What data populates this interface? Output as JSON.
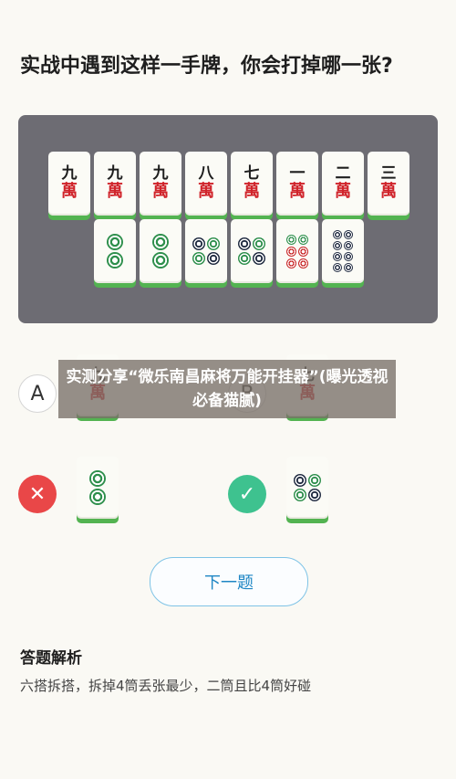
{
  "question": "实战中遇到这样一手牌，你会打掉哪一张?",
  "hand": {
    "top_row": [
      {
        "top": "九",
        "bot": "萬"
      },
      {
        "top": "九",
        "bot": "萬"
      },
      {
        "top": "九",
        "bot": "萬"
      },
      {
        "top": "八",
        "bot": "萬"
      },
      {
        "top": "七",
        "bot": "萬"
      },
      {
        "top": "一",
        "bot": "萬"
      },
      {
        "top": "二",
        "bot": "萬"
      },
      {
        "top": "三",
        "bot": "萬"
      }
    ],
    "bottom_row": [
      "2筒",
      "2筒",
      "4筒",
      "4筒",
      "6筒",
      "8筒"
    ]
  },
  "options": {
    "a_label": "A",
    "b_label": "B",
    "a_tile_top": "九",
    "a_tile_bot": "萬",
    "b_tile_top": "七",
    "b_tile_bot": "萬",
    "wrong_tile": "2筒",
    "right_tile": "4筒"
  },
  "result": {
    "wrong_icon": "close-icon",
    "correct_icon": "check-icon",
    "wrong_color": "#e94748",
    "correct_color": "#3ec28f"
  },
  "overlay_banner": "实测分享“微乐南昌麻将万能开挂器”(曝光透视必备猫腻)",
  "next_button": "下一题",
  "analysis": {
    "title": "答题解析",
    "text": "六搭拆搭，拆掉4筒丢张最少，二筒且比4筒好碰"
  }
}
